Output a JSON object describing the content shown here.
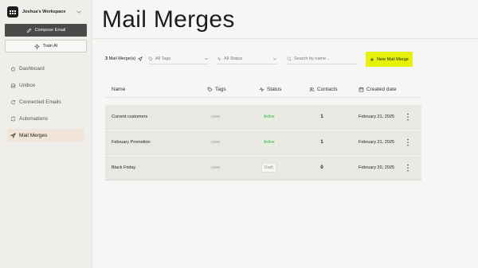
{
  "workspace": {
    "name": "Joshua's Workspace"
  },
  "sidebar": {
    "compose_label": "Compose Email",
    "train_label": "Train AI",
    "items": [
      {
        "label": "Dashboard",
        "icon": "home-icon",
        "active": false
      },
      {
        "label": "Unibox",
        "icon": "inbox-icon",
        "active": false
      },
      {
        "label": "Connected Emails",
        "icon": "refresh-icon",
        "active": false
      },
      {
        "label": "Automations",
        "icon": "automation-icon",
        "active": false
      },
      {
        "label": "Mail Merges",
        "icon": "send-icon",
        "active": true
      }
    ]
  },
  "page": {
    "title": "Mail Merges"
  },
  "toolbar": {
    "count_number": "3",
    "count_label": "Mail Merge(s)",
    "tags_placeholder": "All Tags",
    "status_placeholder": "All Status",
    "search_placeholder": "Search by name...",
    "new_button": "New Mail Merge"
  },
  "table": {
    "headers": {
      "name": "Name",
      "tags": "Tags",
      "status": "Status",
      "contacts": "Contacts",
      "created": "Created date"
    },
    "rows": [
      {
        "name": "Current customers",
        "tags": "none",
        "status": "Active",
        "contacts": "1",
        "created": "February 21, 2025"
      },
      {
        "name": "February Promotion",
        "tags": "none",
        "status": "Active",
        "contacts": "1",
        "created": "February 21, 2025"
      },
      {
        "name": "Black Friday",
        "tags": "none",
        "status": "Draft",
        "contacts": "0",
        "created": "February 20, 2025"
      }
    ]
  },
  "colors": {
    "accent": "#e6f20b",
    "active_status": "#3aa840",
    "nav_active_bg": "#f1e4d8",
    "compose_bg": "#4a4a48"
  }
}
